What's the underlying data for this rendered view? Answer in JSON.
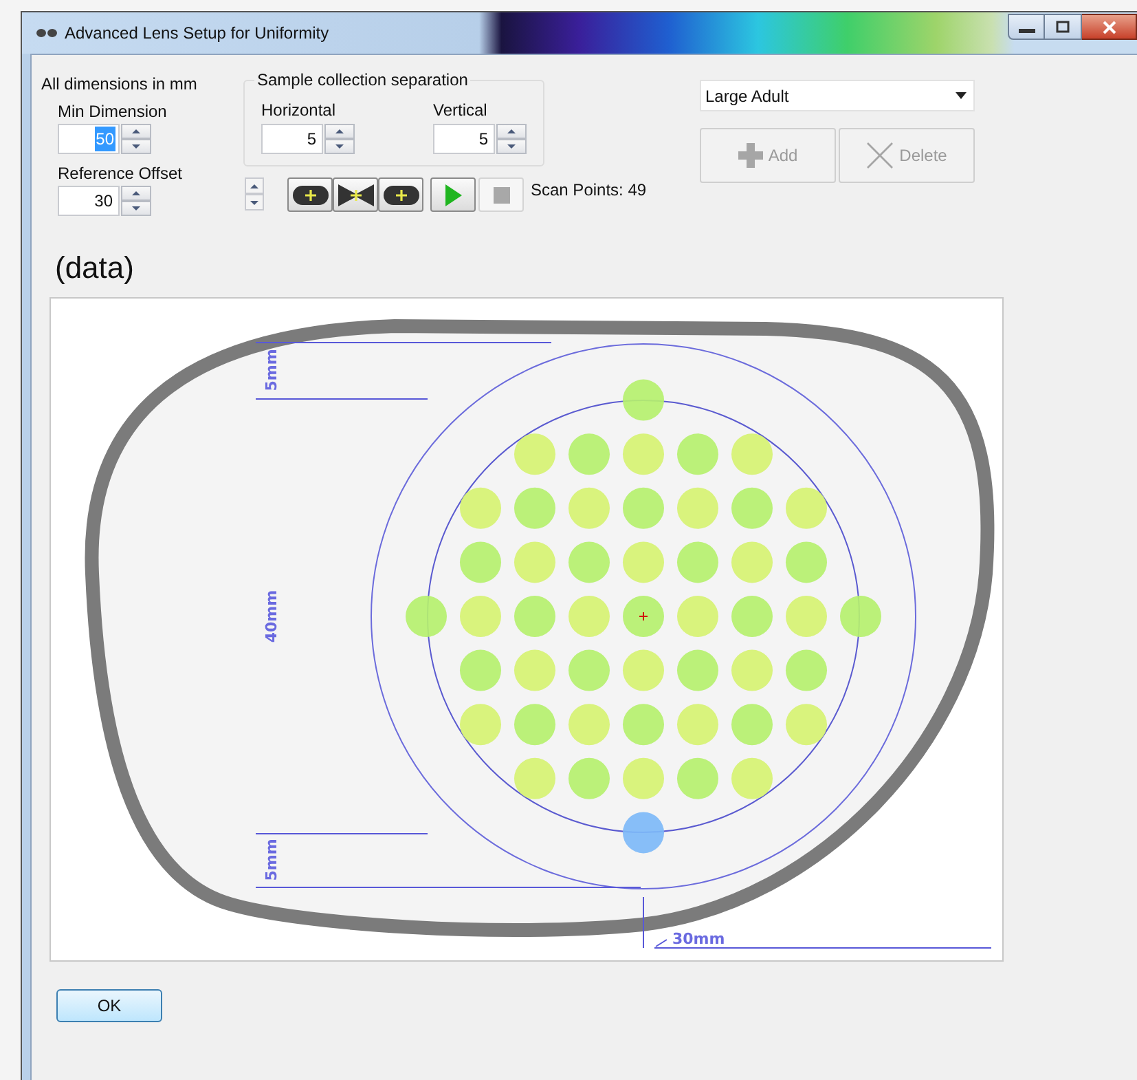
{
  "window": {
    "title": "Advanced Lens Setup for Uniformity"
  },
  "dimensions": {
    "heading": "All dimensions in mm",
    "fields": [
      {
        "label": "Min Dimension",
        "value": "50",
        "selected": true
      },
      {
        "label": "Reference Offset",
        "value": "30",
        "selected": false
      }
    ]
  },
  "separation": {
    "title": "Sample collection separation",
    "fields": [
      {
        "label": "Horizontal",
        "value": "5",
        "selected": false
      },
      {
        "label": "Vertical",
        "value": "5",
        "selected": false
      }
    ]
  },
  "toolbar": {
    "buttons": [
      {
        "kind": "lens-add",
        "disabled": false
      },
      {
        "kind": "bowtie",
        "disabled": false
      },
      {
        "kind": "lens-add",
        "disabled": false
      },
      {
        "kind": "play",
        "disabled": false
      },
      {
        "kind": "stop",
        "disabled": true
      }
    ],
    "scan_points": "Scan Points: 49"
  },
  "profile": {
    "value": "Large Adult"
  },
  "actions": [
    {
      "kind": "add",
      "label": "Add",
      "disabled": true
    },
    {
      "kind": "delete",
      "label": "Delete",
      "disabled": true
    }
  ],
  "view_title": "(data)",
  "diagram": {
    "labels": [
      {
        "kind": "top-gap",
        "text": "5mm"
      },
      {
        "kind": "diameter",
        "text": "40mm"
      },
      {
        "kind": "bottom-gap",
        "text": "5mm"
      },
      {
        "kind": "offset",
        "text": "30mm"
      }
    ]
  },
  "ok_button": "OK"
}
